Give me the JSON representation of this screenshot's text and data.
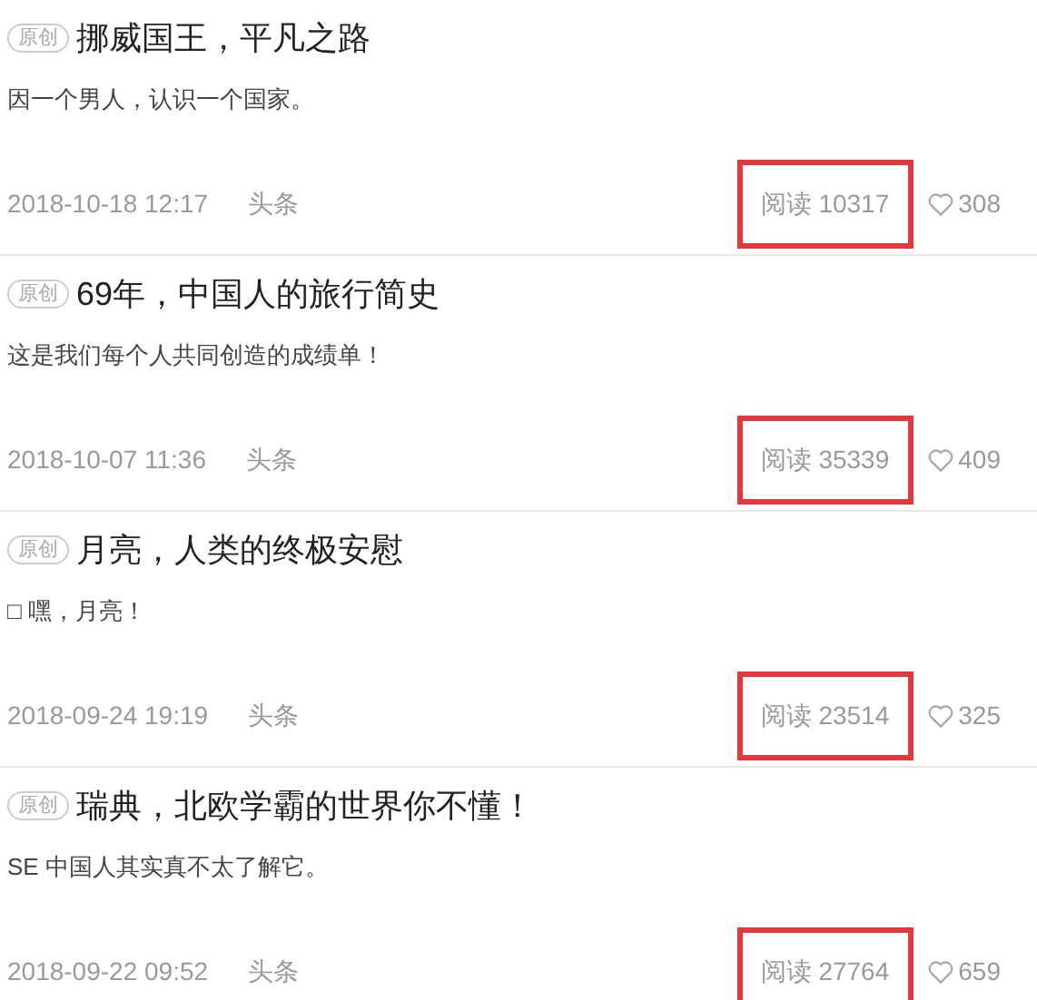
{
  "articles": [
    {
      "badge": "原创",
      "title": "挪威国王，平凡之路",
      "summary": "因一个男人，认识一个国家。",
      "date": "2018-10-18 12:17",
      "channel": "头条",
      "reads": "阅读 10317",
      "likes": "308",
      "highlighted": true
    },
    {
      "badge": "原创",
      "title": "69年，中国人的旅行简史",
      "summary": "这是我们每个人共同创造的成绩单！",
      "date": "2018-10-07 11:36",
      "channel": "头条",
      "reads": "阅读 35339",
      "likes": "409",
      "highlighted": true
    },
    {
      "badge": "原创",
      "title": "月亮，人类的终极安慰",
      "summary": "□ 嘿，月亮！",
      "date": "2018-09-24 19:19",
      "channel": "头条",
      "reads": "阅读 23514",
      "likes": "325",
      "highlighted": true
    },
    {
      "badge": "原创",
      "title": "瑞典，北欧学霸的世界你不懂！",
      "summary": "SE 中国人其实真不太了解它。",
      "date": "2018-09-22 09:52",
      "channel": "头条",
      "reads": "阅读 27764",
      "likes": "659",
      "highlighted": true
    }
  ]
}
